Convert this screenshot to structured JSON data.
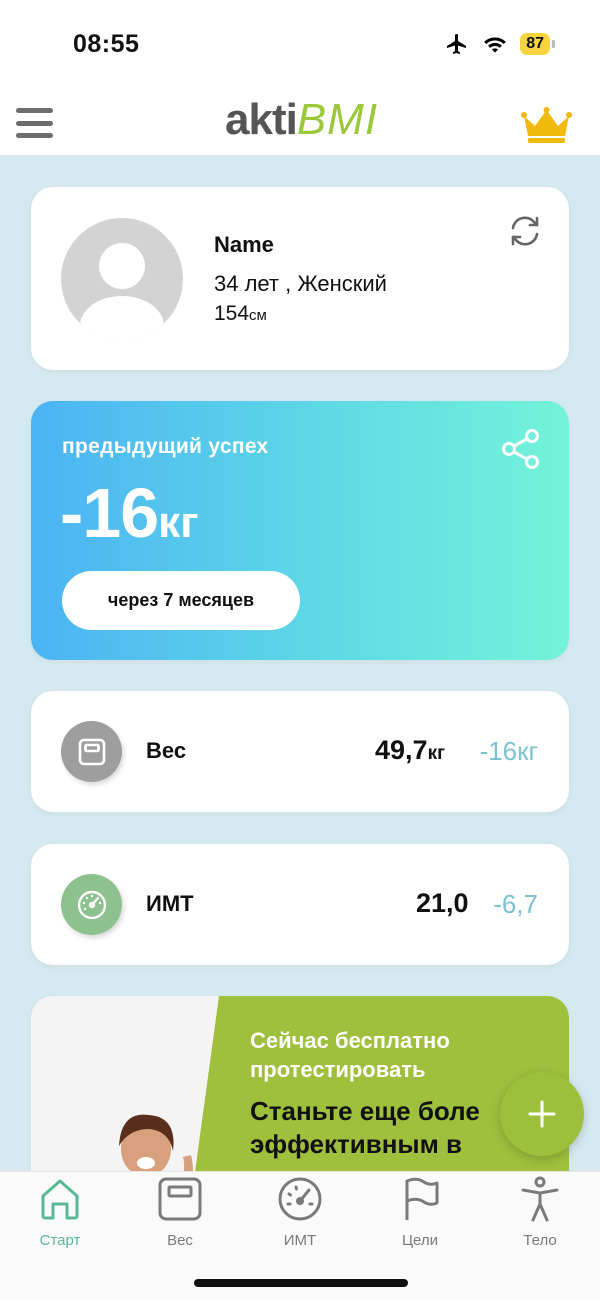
{
  "status_bar": {
    "time": "08:55",
    "battery": "87"
  },
  "header": {
    "logo_part1": "akti",
    "logo_part2": "BMI"
  },
  "profile": {
    "name": "Name",
    "age_gender": "34 лет , Женский",
    "height_value": "154",
    "height_unit": "см"
  },
  "success": {
    "title": "предыдущий успех",
    "value": "-16",
    "unit": "кг",
    "period": "через 7 месяцев"
  },
  "weight": {
    "label": "Вес",
    "value": "49,7",
    "unit": "кг",
    "delta": "-16",
    "delta_unit": "кг"
  },
  "bmi": {
    "label": "ИМТ",
    "value": "21,0",
    "delta": "-6,7"
  },
  "promo": {
    "subtitle_line1": "Сейчас бесплатно",
    "subtitle_line2": "протестировать",
    "headline_line1": "Станьте еще боле",
    "headline_line2": "эффективным в"
  },
  "tabs": [
    {
      "label": "Старт",
      "icon": "home-icon",
      "active": true
    },
    {
      "label": "Вес",
      "icon": "scale-icon",
      "active": false
    },
    {
      "label": "ИМТ",
      "icon": "gauge-icon",
      "active": false
    },
    {
      "label": "Цели",
      "icon": "flag-icon",
      "active": false
    },
    {
      "label": "Тело",
      "icon": "body-icon",
      "active": false
    }
  ],
  "colors": {
    "accent_green": "#9ec03d",
    "active_tab": "#58b893",
    "delta_blue": "#7cc2d2",
    "background": "#d5eaf0"
  }
}
